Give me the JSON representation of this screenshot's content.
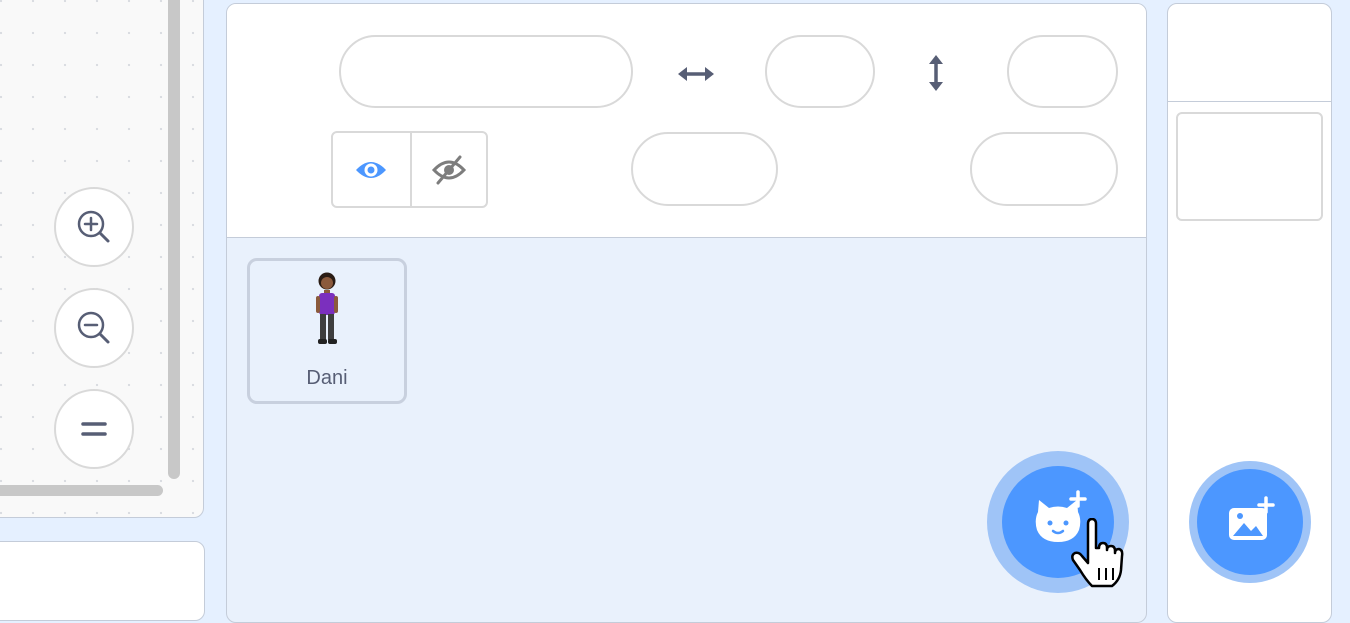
{
  "sprite_info": {
    "sprite_name_value": "",
    "x_value": "",
    "y_value": "",
    "size_value": "",
    "direction_value": "",
    "show": "visible"
  },
  "sprites": [
    {
      "name": "Dani",
      "selected": true
    }
  ],
  "icons": {
    "zoom_in": "zoom-in-icon",
    "zoom_out": "zoom-out-icon",
    "zoom_reset": "equals-icon",
    "x_axis": "horizontal-arrow-icon",
    "y_axis": "vertical-arrow-icon",
    "show": "eye-icon",
    "hide": "eye-slash-icon",
    "add_sprite": "cat-plus-icon",
    "add_backdrop": "image-plus-icon",
    "cursor": "hand-pointer-icon"
  },
  "colors": {
    "accent": "#4c97ff",
    "accent_light": "#9fc4f7",
    "background": "#e5f0ff",
    "text": "#575e75"
  }
}
